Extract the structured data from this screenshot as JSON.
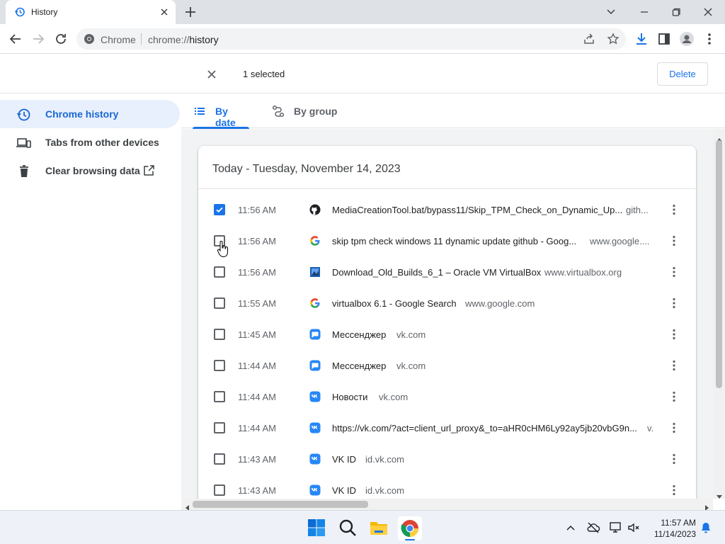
{
  "browser": {
    "tab_title": "History",
    "omnibox_site": "Chrome",
    "url_scheme": "chrome://",
    "url_host": "history"
  },
  "selection": {
    "count_label": "1 selected",
    "delete_label": "Delete"
  },
  "sidebar": {
    "items": [
      {
        "label": "Chrome history",
        "icon": "history-icon",
        "active": true
      },
      {
        "label": "Tabs from other devices",
        "icon": "devices-icon",
        "active": false
      },
      {
        "label": "Clear browsing data",
        "icon": "trash-icon",
        "active": false
      }
    ]
  },
  "view_tabs": {
    "by_date": "By date",
    "by_group": "By group"
  },
  "history": {
    "date_header": "Today - Tuesday, November 14, 2023",
    "rows": [
      {
        "time": "11:56 AM",
        "title": "MediaCreationTool.bat/bypass11/Skip_TPM_Check_on_Dynamic_Up...",
        "domain": "gith...",
        "favicon": "github-icon",
        "checked": true
      },
      {
        "time": "11:56 AM",
        "title": "skip tpm check windows 11 dynamic update github - Goog...",
        "domain": "www.google....",
        "favicon": "google-icon",
        "checked": false
      },
      {
        "time": "11:56 AM",
        "title": "Download_Old_Builds_6_1 – Oracle VM VirtualBox",
        "domain": "www.virtualbox.org",
        "favicon": "virtualbox-icon",
        "checked": false
      },
      {
        "time": "11:55 AM",
        "title": "virtualbox 6.1 - Google Search",
        "domain": "www.google.com",
        "favicon": "google-icon",
        "checked": false
      },
      {
        "time": "11:45 AM",
        "title": "Мессенджер",
        "domain": "vk.com",
        "favicon": "vk-messenger-icon",
        "checked": false
      },
      {
        "time": "11:44 AM",
        "title": "Мессенджер",
        "domain": "vk.com",
        "favicon": "vk-messenger-icon",
        "checked": false
      },
      {
        "time": "11:44 AM",
        "title": "Новости",
        "domain": "vk.com",
        "favicon": "vk-icon",
        "checked": false
      },
      {
        "time": "11:44 AM",
        "title": "https://vk.com/?act=client_url_proxy&_to=aHR0cHM6Ly92ay5jb20vbG9n...",
        "domain": "v.",
        "favicon": "vk-icon",
        "checked": false
      },
      {
        "time": "11:43 AM",
        "title": "VK ID",
        "domain": "id.vk.com",
        "favicon": "vk-icon",
        "checked": false
      },
      {
        "time": "11:43 AM",
        "title": "VK ID",
        "domain": "id.vk.com",
        "favicon": "vk-icon",
        "checked": false
      }
    ]
  },
  "taskbar": {
    "time": "11:57 AM",
    "date": "11/14/2023"
  },
  "colors": {
    "accent": "#1a73e8",
    "sidebar_active_bg": "#e8f0fe",
    "content_bg": "#f1f3f4"
  }
}
